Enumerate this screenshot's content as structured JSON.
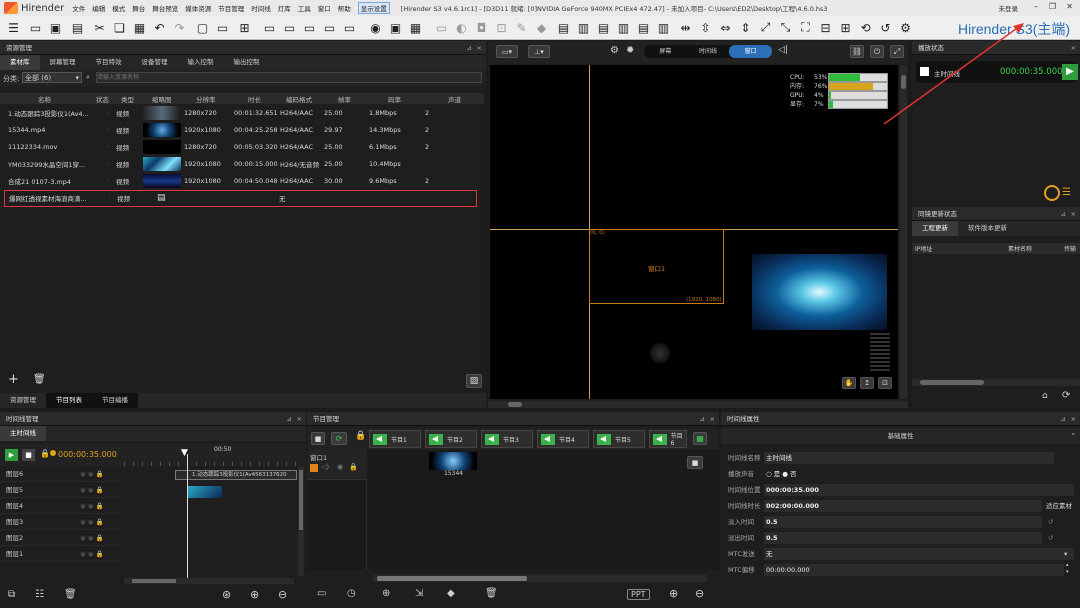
{
  "titlebar": {
    "app": "Hirender",
    "menus": [
      "文件",
      "编辑",
      "模式",
      "舞台",
      "舞台预览",
      "媒体资源",
      "节目管理",
      "时间线",
      "灯库",
      "工具",
      "窗口",
      "帮助"
    ],
    "active_menu": "显示设置",
    "info": "[Hirender S3 v4.6.1rc1] - [D3D11 就绪: [0]NVIDIA GeForce 940MX PCIEx4 472.47] - 未加入项目- C:\\Users\\EDZ\\Desktop\\工程\\4.6.0.hs3",
    "login": "未登录",
    "brand": "Hirender S3(主端)"
  },
  "resource": {
    "title": "资源管理",
    "tabs": [
      "素材库",
      "屏幕管理",
      "节目特效",
      "设备管理",
      "输入控制",
      "输出控制"
    ],
    "filter_label": "分类:",
    "filter_value": "全部 (6)",
    "search_placeholder": "请输入资源名称",
    "columns": [
      "名称",
      "状态",
      "类型",
      "缩略图",
      "分辨率",
      "时长",
      "编码格式",
      "帧率",
      "码率",
      "声道"
    ],
    "rows": [
      {
        "name": "1.动态跟踪3投影仪1(Av4...",
        "type": "视频",
        "res": "1280x720",
        "dur": "00:01:32.651",
        "codec": "H264/AAC",
        "fps": "25.00",
        "rate": "1.8Mbps",
        "ch": "2"
      },
      {
        "name": "15344.mp4",
        "type": "视频",
        "res": "1920x1080",
        "dur": "00:04:25.258",
        "codec": "H264/AAC",
        "fps": "29.97",
        "rate": "14.3Mbps",
        "ch": "2"
      },
      {
        "name": "11122334.mov",
        "type": "视频",
        "res": "1280x720",
        "dur": "00:05:03.320",
        "codec": "H264/AAC",
        "fps": "25.00",
        "rate": "6.1Mbps",
        "ch": "2"
      },
      {
        "name": "YM033299水晶空间1穿...",
        "type": "视频",
        "res": "1920x1080",
        "dur": "00:00:15.000",
        "codec": "H264/无音频",
        "fps": "25.00",
        "rate": "10.4Mbps",
        "ch": ""
      },
      {
        "name": "合成21 0107-3.mp4",
        "type": "视频",
        "res": "1920x1080",
        "dur": "00:04:50.048",
        "codec": "H264/AAC",
        "fps": "30.00",
        "rate": "9.6Mbps",
        "ch": "2"
      },
      {
        "name": "爆网红透视素材海浪商滴...",
        "type": "视频",
        "res": "",
        "dur": "无",
        "codec": "",
        "fps": "",
        "rate": "",
        "ch": ""
      }
    ],
    "bottom_tabs": [
      "资源管理",
      "节目列表",
      "节目编播"
    ]
  },
  "preview": {
    "modes": [
      "屏幕",
      "时间线",
      "窗口"
    ],
    "active_mode": "窗口",
    "stats": [
      {
        "label": "CPU:",
        "value": "53%",
        "level": 0.53,
        "color": "#2ebd3a"
      },
      {
        "label": "内存:",
        "value": "76%",
        "level": 0.76,
        "color": "#d8a21a"
      },
      {
        "label": "GPU:",
        "value": "4%",
        "level": 0.04,
        "color": "#2ebd3a"
      },
      {
        "label": "显存:",
        "value": "7%",
        "level": 0.07,
        "color": "#2ebd3a"
      }
    ],
    "origin": "(0, 0)",
    "window_label": "窗口1",
    "window_size": "(1920, 1080)"
  },
  "playstate": {
    "title": "播放状态",
    "item": "主时间线",
    "time": "000:00:35.000"
  },
  "netupdate": {
    "title": "同镜更新状态",
    "tabs": [
      "工程更新",
      "软件版本更新"
    ],
    "cols": [
      "IP地址",
      "素材名称",
      "传输"
    ]
  },
  "timeline": {
    "title": "时间线管理",
    "tab": "主时间线",
    "time": "000:00:35.000",
    "tick": "00:50",
    "layers": [
      "图层6",
      "图层5",
      "图层4",
      "图层3",
      "图层2",
      "图层1"
    ],
    "clip_label": "1.动态跟踪3投影仪1(Av4563137620"
  },
  "program": {
    "title": "节目管理",
    "programs": [
      "节目1",
      "节目2",
      "节目3",
      "节目4",
      "节目5",
      "节目6"
    ],
    "window_label": "窗口1",
    "clip": "15344",
    "ppt": "PPT"
  },
  "props": {
    "title": "时间线属性",
    "section": "基础属性",
    "rows": [
      {
        "label": "时间线名称",
        "value": "主时间线"
      },
      {
        "label": "播放声音",
        "value": "○ 是  ● 否"
      },
      {
        "label": "时间线位置",
        "value": "000:00:35.000"
      },
      {
        "label": "时间线时长",
        "value": "002:00:00.000",
        "extra": "适应素材"
      },
      {
        "label": "淡入时间",
        "value": "0.5"
      },
      {
        "label": "淡出时间",
        "value": "0.5"
      },
      {
        "label": "MTC发送",
        "value": "无"
      },
      {
        "label": "MTC偏移",
        "value": "00:00:00.000"
      }
    ]
  }
}
